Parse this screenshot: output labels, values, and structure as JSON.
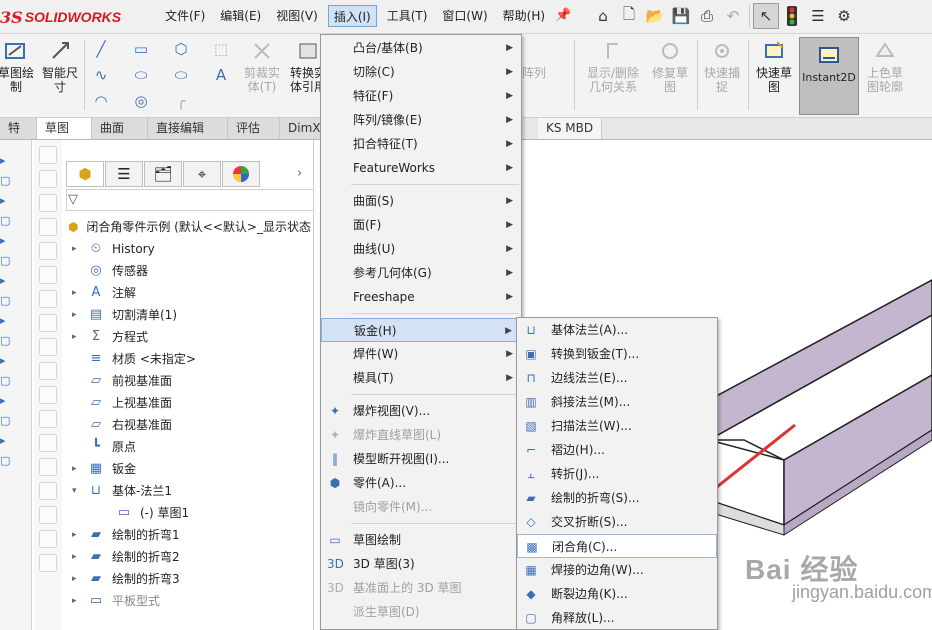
{
  "app": {
    "logo_prefix": "3S",
    "logo_text": "SOLIDWORKS"
  },
  "menubar": [
    {
      "label": "文件(F)"
    },
    {
      "label": "编辑(E)"
    },
    {
      "label": "视图(V)"
    },
    {
      "label": "插入(I)",
      "active": true
    },
    {
      "label": "工具(T)"
    },
    {
      "label": "窗口(W)"
    },
    {
      "label": "帮助(H)"
    }
  ],
  "ribbon": {
    "sketch_draw": "草图绘\n制",
    "smart_dim": "智能尺\n寸",
    "trim": "剪裁实\n体(T)",
    "convert": "转换实\n体引用",
    "pattern": "阵列",
    "show_delete": "显示/删除\n几何关系",
    "repair": "修复草\n图",
    "quick_snap": "快速捕\n捉",
    "quick_sketch": "快速草\n图",
    "instant2d": "Instant2D",
    "shaded_sketch": "上色草\n图轮廓"
  },
  "tabs": [
    "特征",
    "草图",
    "曲面",
    "直接编辑",
    "评估",
    "DimXpe",
    "KS MBD"
  ],
  "tree": {
    "root": "闭合角零件示例 (默认<<默认>_显示状态",
    "nodes": [
      {
        "label": "History",
        "icon": "history-icon",
        "twisty": true
      },
      {
        "label": "传感器",
        "icon": "sensor-icon",
        "twisty": false
      },
      {
        "label": "注解",
        "icon": "annotation-icon",
        "twisty": true
      },
      {
        "label": "切割清单(1)",
        "icon": "cutlist-icon",
        "twisty": true
      },
      {
        "label": "方程式",
        "icon": "equation-icon",
        "twisty": true
      },
      {
        "label": "材质 <未指定>",
        "icon": "material-icon",
        "twisty": false
      },
      {
        "label": "前视基准面",
        "icon": "plane-icon",
        "twisty": false
      },
      {
        "label": "上视基准面",
        "icon": "plane-icon",
        "twisty": false
      },
      {
        "label": "右视基准面",
        "icon": "plane-icon",
        "twisty": false
      },
      {
        "label": "原点",
        "icon": "origin-icon",
        "twisty": false
      },
      {
        "label": "钣金",
        "icon": "sheetmetal-icon",
        "twisty": true
      },
      {
        "label": "基体-法兰1",
        "icon": "base-flange-icon",
        "twisty": true,
        "expanded": true
      },
      {
        "label": "(-) 草图1",
        "icon": "sketch-icon",
        "twisty": false,
        "indent": true
      },
      {
        "label": "绘制的折弯1",
        "icon": "sketched-bend-icon",
        "twisty": true
      },
      {
        "label": "绘制的折弯2",
        "icon": "sketched-bend-icon",
        "twisty": true
      },
      {
        "label": "绘制的折弯3",
        "icon": "sketched-bend-icon",
        "twisty": true
      },
      {
        "label": "平板型式",
        "icon": "flat-pattern-icon",
        "twisty": true,
        "dim": true
      }
    ]
  },
  "insert_menu": [
    {
      "label": "凸台/基体(B)",
      "sub": true
    },
    {
      "label": "切除(C)",
      "sub": true
    },
    {
      "label": "特征(F)",
      "sub": true
    },
    {
      "label": "阵列/镜像(E)",
      "sub": true
    },
    {
      "label": "扣合特征(T)",
      "sub": true
    },
    {
      "label": "FeatureWorks",
      "sub": true
    },
    {
      "sep": true
    },
    {
      "label": "曲面(S)",
      "sub": true
    },
    {
      "label": "面(F)",
      "sub": true
    },
    {
      "label": "曲线(U)",
      "sub": true
    },
    {
      "label": "参考几何体(G)",
      "sub": true
    },
    {
      "label": "Freeshape",
      "sub": true
    },
    {
      "sep": true
    },
    {
      "label": "钣金(H)",
      "sub": true,
      "highlight": true
    },
    {
      "label": "焊件(W)",
      "sub": true
    },
    {
      "label": "模具(T)",
      "sub": true
    },
    {
      "sep": true
    },
    {
      "label": "爆炸视图(V)...",
      "icon": "explode-view-icon"
    },
    {
      "label": "爆炸直线草图(L)",
      "icon": "explode-line-icon",
      "disabled": true
    },
    {
      "label": "模型断开视图(I)...",
      "icon": "broken-view-icon"
    },
    {
      "label": "零件(A)...",
      "icon": "part-icon"
    },
    {
      "label": "镜向零件(M)...",
      "disabled": true
    },
    {
      "sep": true
    },
    {
      "label": "草图绘制",
      "icon": "sketch-icon"
    },
    {
      "label": "3D 草图(3)",
      "icon": "3d-sketch-icon"
    },
    {
      "label": "基准面上的 3D 草图",
      "icon": "3d-sketch-plane-icon",
      "disabled": true
    },
    {
      "label": "派生草图(D)",
      "disabled": true
    }
  ],
  "sheetmetal_menu": [
    {
      "label": "基体法兰(A)...",
      "icon": "base-flange-icon"
    },
    {
      "label": "转换到钣金(T)...",
      "icon": "convert-sheetmetal-icon"
    },
    {
      "label": "边线法兰(E)...",
      "icon": "edge-flange-icon"
    },
    {
      "label": "斜接法兰(M)...",
      "icon": "miter-flange-icon"
    },
    {
      "label": "扫描法兰(W)...",
      "icon": "swept-flange-icon"
    },
    {
      "label": "褶边(H)...",
      "icon": "hem-icon"
    },
    {
      "label": "转折(J)...",
      "icon": "jog-icon"
    },
    {
      "label": "绘制的折弯(S)...",
      "icon": "sketched-bend-icon"
    },
    {
      "label": "交叉折断(S)...",
      "icon": "cross-break-icon"
    },
    {
      "label": "闭合角(C)...",
      "icon": "closed-corner-icon",
      "boxed": true
    },
    {
      "label": "焊接的边角(W)...",
      "icon": "welded-corner-icon"
    },
    {
      "label": "断裂边角(K)...",
      "icon": "break-corner-icon"
    },
    {
      "label": "角释放(L)...",
      "icon": "corner-relief-icon"
    }
  ],
  "watermark": {
    "main": "Bai 经验",
    "sub": "jingyan.baidu.com"
  },
  "colors": {
    "accent": "#d71920",
    "highlight": "#d3e3f5",
    "part_face": "#c5b6cf",
    "arrow": "#e03030"
  }
}
